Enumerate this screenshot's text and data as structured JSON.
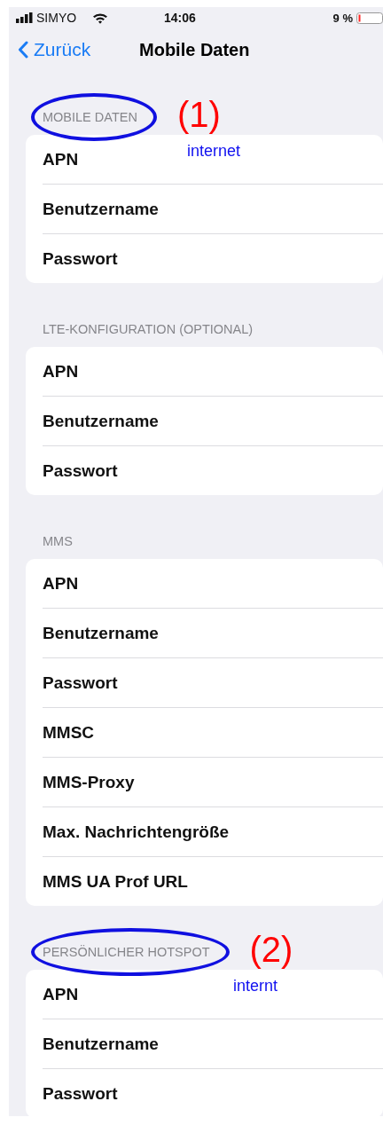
{
  "status_bar": {
    "carrier": "SIMYO",
    "time": "14:06",
    "battery": "9 %"
  },
  "nav": {
    "back": "Zurück",
    "title": "Mobile Daten"
  },
  "sections": [
    {
      "title": "MOBILE DATEN",
      "circled": true,
      "marker": "(1)",
      "rows": [
        {
          "label": "APN",
          "value": "internet"
        },
        {
          "label": "Benutzername"
        },
        {
          "label": "Passwort"
        }
      ]
    },
    {
      "title": "LTE-KONFIGURATION (OPTIONAL)",
      "circled": false,
      "rows": [
        {
          "label": "APN"
        },
        {
          "label": "Benutzername"
        },
        {
          "label": "Passwort"
        }
      ]
    },
    {
      "title": "MMS",
      "circled": false,
      "rows": [
        {
          "label": "APN"
        },
        {
          "label": "Benutzername"
        },
        {
          "label": "Passwort"
        },
        {
          "label": "MMSC"
        },
        {
          "label": "MMS-Proxy"
        },
        {
          "label": "Max. Nachrichtengröße"
        },
        {
          "label": "MMS UA Prof URL"
        }
      ]
    },
    {
      "title": "PERSÖNLICHER HOTSPOT",
      "circled": true,
      "marker": "(2)",
      "rows": [
        {
          "label": "APN",
          "value": "internt"
        },
        {
          "label": "Benutzername"
        },
        {
          "label": "Passwort"
        }
      ]
    }
  ]
}
